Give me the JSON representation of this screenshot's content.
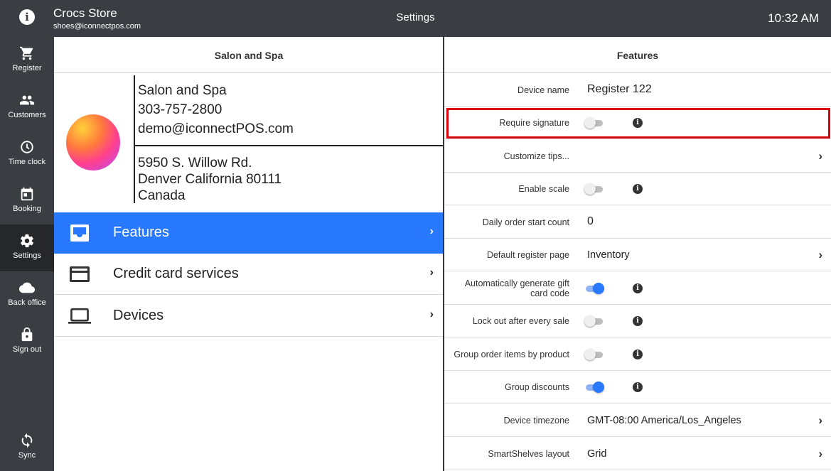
{
  "topbar": {
    "info_icon": "info-icon",
    "store_name": "Crocs Store",
    "store_email": "shoes@iconnectpos.com",
    "title": "Settings",
    "time": "10:32 AM"
  },
  "sidenav": {
    "items": [
      {
        "label": "Register",
        "icon": "cart-icon"
      },
      {
        "label": "Customers",
        "icon": "people-icon"
      },
      {
        "label": "Time clock",
        "icon": "clock-icon"
      },
      {
        "label": "Booking",
        "icon": "calendar-icon"
      },
      {
        "label": "Settings",
        "icon": "gear-icon",
        "active": true
      },
      {
        "label": "Back office",
        "icon": "cloud-icon"
      },
      {
        "label": "Sign out",
        "icon": "lock-icon"
      }
    ],
    "sync_label": "Sync"
  },
  "store_panel": {
    "header": "Salon and Spa",
    "name": "Salon and Spa",
    "phone": "303-757-2800",
    "email": "demo@iconnectPOS.com",
    "address_line1": "5950 S. Willow Rd.",
    "address_line2": "Denver California 80111",
    "country": "Canada",
    "menu": [
      {
        "label": "Features",
        "icon": "inbox-icon",
        "selected": true
      },
      {
        "label": "Credit card services",
        "icon": "credit-card-icon"
      },
      {
        "label": "Devices",
        "icon": "laptop-icon"
      }
    ]
  },
  "features": {
    "header": "Features",
    "rows": [
      {
        "label": "Device name",
        "value": "Register 122"
      },
      {
        "label": "Require signature",
        "toggle": false,
        "info": true
      },
      {
        "label": "Customize tips...",
        "chevron": true
      },
      {
        "label": "Enable scale",
        "toggle": false,
        "info": true
      },
      {
        "label": "Daily order start count",
        "value": "0"
      },
      {
        "label": "Default register page",
        "value": "Inventory",
        "chevron": true
      },
      {
        "label": "Automatically generate gift card code",
        "toggle": true,
        "info": true
      },
      {
        "label": "Lock out after every sale",
        "toggle": false,
        "info": true
      },
      {
        "label": "Group order items by product",
        "toggle": false,
        "info": true
      },
      {
        "label": "Group discounts",
        "toggle": true,
        "info": true
      },
      {
        "label": "Device timezone",
        "value": "GMT-08:00 America/Los_Angeles",
        "chevron": true
      },
      {
        "label": "SmartShelves layout",
        "value": "Grid",
        "chevron": true
      }
    ]
  },
  "colors": {
    "topbar": "#3a3d42",
    "accent": "#2979ff",
    "highlight": "#d9000d"
  }
}
